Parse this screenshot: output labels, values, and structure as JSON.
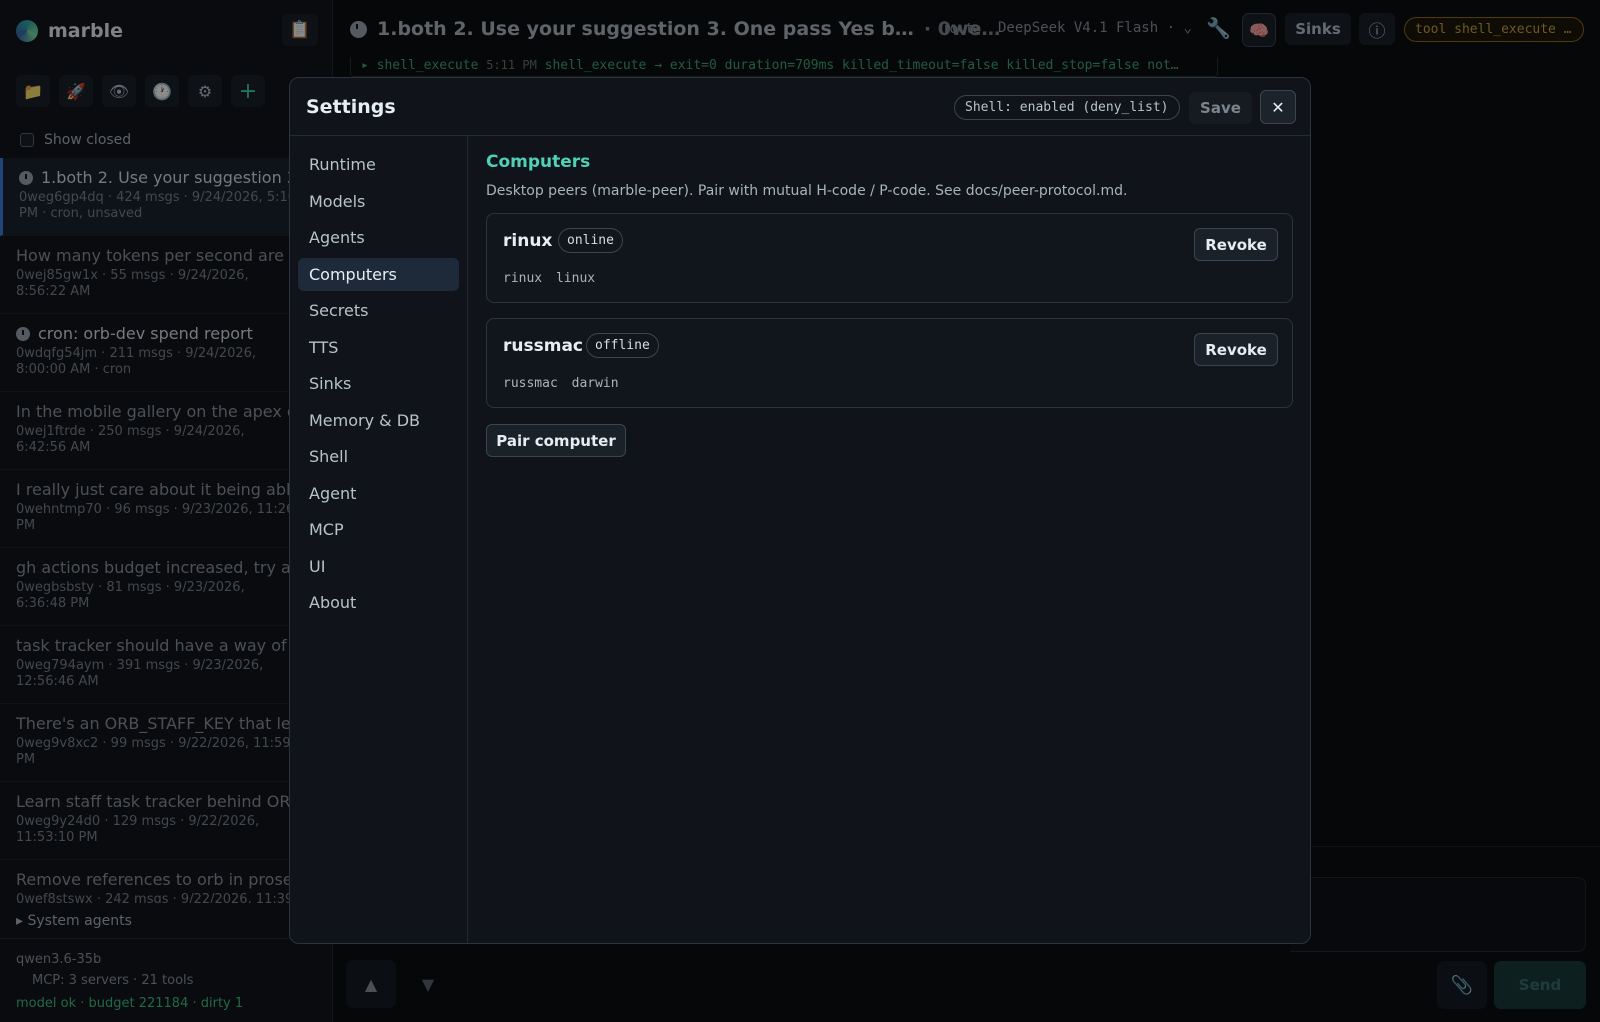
{
  "app": {
    "name": "marble"
  },
  "sidebar": {
    "show_closed_label": "Show closed",
    "conversations": [
      {
        "title": "1.both 2. Use your suggestion 3. One pass Yes b",
        "meta": "0weg6gp4dq · 424 msgs · 9/24/2026, 5:10 PM · cron, unsaved",
        "clock": true
      },
      {
        "title": "How many tokens per second are we",
        "meta": "0wej85gw1x · 55 msgs · 9/24/2026, 8:56:22 AM",
        "clock": false
      },
      {
        "title": "cron: orb-dev spend report",
        "meta": "0wdqfg54jm · 211 msgs · 9/24/2026, 8:00:00 AM · cron",
        "clock": true
      },
      {
        "title": "In the mobile gallery on the apex of",
        "meta": "0wej1ftrde · 250 msgs · 9/24/2026, 6:42:56 AM",
        "clock": false
      },
      {
        "title": "I really just care about it being able",
        "meta": "0wehntmp70 · 96 msgs · 9/23/2026, 11:26 PM",
        "clock": false
      },
      {
        "title": "gh actions budget increased, try ag",
        "meta": "0wegbsbsty · 81 msgs · 9/23/2026, 6:36:48 PM",
        "clock": false
      },
      {
        "title": "task tracker should have a way of t",
        "meta": "0weg794aym · 391 msgs · 9/23/2026, 12:56:46 AM",
        "clock": false
      },
      {
        "title": "There's an ORB_STAFF_KEY that let",
        "meta": "0weg9v8xc2 · 99 msgs · 9/22/2026, 11:59 PM",
        "clock": false
      },
      {
        "title": "Learn staff task tracker behind ORB",
        "meta": "0weg9y24d0 · 129 msgs · 9/22/2026, 11:53:10 PM",
        "clock": false
      },
      {
        "title": "Remove references to orb in prose",
        "meta": "0wef8stswx · 242 msgs · 9/22/2026, 11:39",
        "clock": false
      }
    ],
    "system_agents_label": "▸ System agents",
    "footer": {
      "model": "qwen3.6-35b",
      "mcp": "MCP: 3 servers · 21 tools",
      "status": "model ok · budget 221184 · dirty 1"
    }
  },
  "topbar": {
    "title": "1.both 2. Use your suggestion 3. One pass Yes b…",
    "subtitle": "· 0we…",
    "route_label": "route",
    "model": "DeepSeek V4.1 Flash",
    "sinks_label": "Sinks",
    "tool_badge": "tool shell_execute …"
  },
  "tool_event": {
    "name": "shell_execute",
    "time": "5:11 PM",
    "summary": "shell_execute → exit=0 duration=709ms killed_timeout=false killed_stop=false not…"
  },
  "composer": {
    "send_label": "Send"
  },
  "settings": {
    "title": "Settings",
    "shell_badge": "Shell: enabled (deny_list)",
    "save_label": "Save",
    "nav": [
      "Runtime",
      "Models",
      "Agents",
      "Computers",
      "Secrets",
      "TTS",
      "Sinks",
      "Memory & DB",
      "Shell",
      "Agent",
      "MCP",
      "UI",
      "About"
    ],
    "active_nav": "Computers",
    "section": {
      "heading": "Computers",
      "description": "Desktop peers (marble-peer). Pair with mutual H-code / P-code. See docs/peer-protocol.md.",
      "computers": [
        {
          "name": "rinux",
          "status": "online",
          "tags": [
            "rinux",
            "linux"
          ],
          "revoke_label": "Revoke"
        },
        {
          "name": "russmac",
          "status": "offline",
          "tags": [
            "russmac",
            "darwin"
          ],
          "revoke_label": "Revoke"
        }
      ],
      "pair_label": "Pair computer"
    }
  },
  "colors": {
    "accent": "#4fd1b8",
    "link": "#3d7ce0",
    "ok": "#3fbf7f",
    "warn": "#c9a240"
  }
}
